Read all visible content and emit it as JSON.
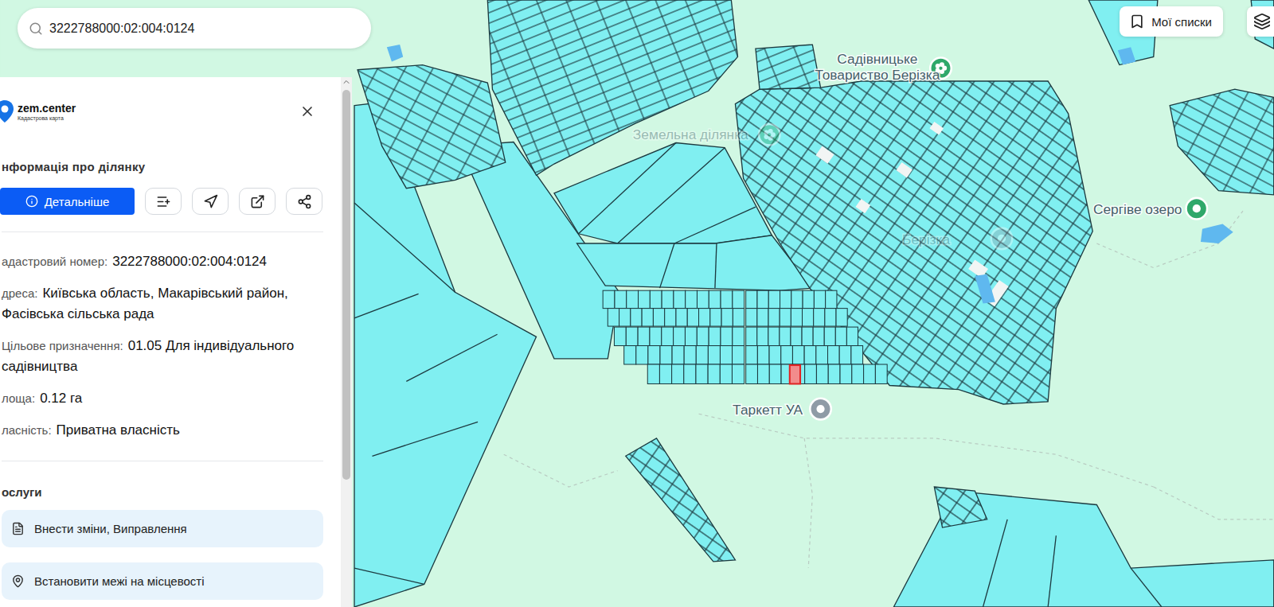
{
  "search": {
    "value": "3222788000:02:004:0124"
  },
  "toolbar": {
    "lists_button": "Мої списки"
  },
  "panel": {
    "logo": {
      "name": "zem.center",
      "subtitle": "Кадастрова карта"
    },
    "title": "нформація про ділянку",
    "details_button": "Детальніше",
    "fields": [
      {
        "label": "адастровий номер:",
        "value": "3222788000:02:004:0124"
      },
      {
        "label": "дреса:",
        "value": "Київська область, Макарівський район, Фасівська сільська рада"
      },
      {
        "label": "Цільове призначення:",
        "value": "01.05 Для індивідуального садівництва"
      },
      {
        "label": "лоща:",
        "value": "0.12 га"
      },
      {
        "label": "ласність:",
        "value": "Приватна власність"
      }
    ],
    "services_title": "ослуги",
    "services": [
      "Внести зміни, Виправлення",
      "Встановити межі на місцевості"
    ]
  },
  "map": {
    "selected_parcel": {
      "highlighted": true
    },
    "pins": [
      {
        "label_lines": [
          "Садівницьке",
          "Товариство Берізка"
        ],
        "kind": "garden"
      },
      {
        "label_lines": [
          "Земельна ділянка"
        ],
        "kind": "faint-garden"
      },
      {
        "label_lines": [
          "Берізка"
        ],
        "kind": "faint"
      },
      {
        "label_lines": [
          "Сергіве озеро"
        ],
        "kind": "place"
      },
      {
        "label_lines": [
          "Таркетт УА"
        ],
        "kind": "company"
      }
    ]
  }
}
